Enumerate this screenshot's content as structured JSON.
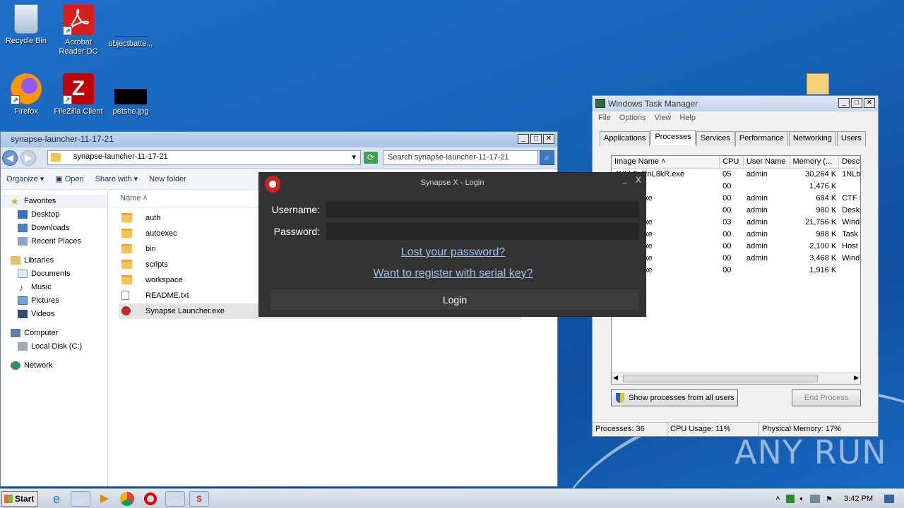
{
  "desktop": {
    "icons": [
      {
        "label": "Recycle Bin"
      },
      {
        "label": "Acrobat Reader DC"
      },
      {
        "label": "objectbatte..."
      },
      {
        "label": "Firefox"
      },
      {
        "label": "FileZilla Client"
      },
      {
        "label": "petshe.jpg"
      }
    ]
  },
  "explorer": {
    "title": "synapse-launcher-11-17-21",
    "address": "synapse-launcher-11-17-21",
    "search_placeholder": "Search synapse-launcher-11-17-21",
    "toolbar": [
      "Organize",
      "Open",
      "Share with",
      "New folder"
    ],
    "nav": {
      "favorites": "Favorites",
      "favorites_items": [
        "Desktop",
        "Downloads",
        "Recent Places"
      ],
      "libraries": "Libraries",
      "libraries_items": [
        "Documents",
        "Music",
        "Pictures",
        "Videos"
      ],
      "computer": "Computer",
      "computer_items": [
        "Local Disk (C:)"
      ],
      "network": "Network"
    },
    "column_name": "Name",
    "files": [
      {
        "name": "auth",
        "type": "folder"
      },
      {
        "name": "autoexec",
        "type": "folder"
      },
      {
        "name": "bin",
        "type": "folder"
      },
      {
        "name": "scripts",
        "type": "folder"
      },
      {
        "name": "workspace",
        "type": "folder"
      },
      {
        "name": "README.txt",
        "type": "text"
      },
      {
        "name": "Synapse Launcher.exe",
        "type": "exe"
      }
    ]
  },
  "synapse": {
    "title": "Synapse X - Login",
    "close": "X",
    "minimize": "_",
    "username_label": "Username:",
    "password_label": "Password:",
    "lost_password": "Lost your password?",
    "register": "Want to register with serial key?",
    "login": "Login"
  },
  "taskmanager": {
    "title": "Windows Task Manager",
    "menu": [
      "File",
      "Options",
      "View",
      "Help"
    ],
    "tabs": [
      "Applications",
      "Processes",
      "Services",
      "Performance",
      "Networking",
      "Users"
    ],
    "columns": [
      "Image Name",
      "CPU",
      "User Name",
      "Memory (...",
      "Desc"
    ],
    "rows": [
      [
        "4NLbFcRnL8kR.exe",
        "05",
        "admin",
        "30,264 K",
        "1NLb"
      ],
      [
        "e",
        "00",
        "",
        "1,476 K",
        ""
      ],
      [
        "exe",
        "00",
        "admin",
        "684 K",
        "CTF I"
      ],
      [
        "",
        "00",
        "admin",
        "980 K",
        "Desk"
      ],
      [
        "exe",
        "03",
        "admin",
        "21,756 K",
        "Wind"
      ],
      [
        "exe",
        "00",
        "admin",
        "988 K",
        "Task"
      ],
      [
        "exe",
        "00",
        "admin",
        "2,100 K",
        "Host"
      ],
      [
        "exe",
        "00",
        "admin",
        "3,468 K",
        "Wind"
      ],
      [
        "exe",
        "00",
        "",
        "1,916 K",
        ""
      ]
    ],
    "show_all": "Show processes from all users",
    "end_process": "End Process",
    "status": {
      "processes": "Processes: 36",
      "cpu": "CPU Usage: 11%",
      "memory": "Physical Memory: 17%"
    }
  },
  "taskbar": {
    "start": "Start",
    "clock": "3:42 PM"
  },
  "watermark": "ANY RUN"
}
